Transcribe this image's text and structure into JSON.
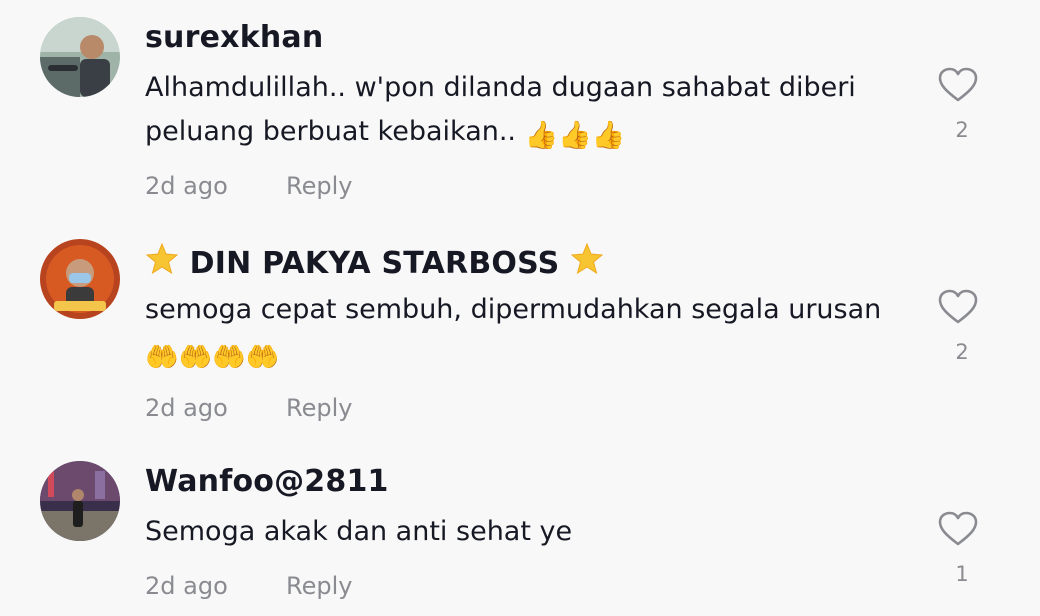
{
  "comments": [
    {
      "username": "surexkhan",
      "text": "Alhamdulillah.. w'pon dilanda dugaan sahabat diberi peluang berbuat kebaikan..",
      "emoji": "👍👍👍",
      "time": "2d ago",
      "reply_label": "Reply",
      "likes": "2",
      "avatar_icon": "user-in-car-photo"
    },
    {
      "username": "DIN PAKYA STARBOSS",
      "username_decoration": "🌟",
      "text": "semoga cepat sembuh, dipermudahkan segala urusan",
      "emoji": "🤲🤲🤲🤲",
      "time": "2d ago",
      "reply_label": "Reply",
      "likes": "2",
      "avatar_icon": "starboss-logo-photo"
    },
    {
      "username": "Wanfoo@2811",
      "text": "Semoga akak dan anti sehat ye",
      "time": "2d ago",
      "reply_label": "Reply",
      "likes": "1",
      "avatar_icon": "user-city-night-photo"
    }
  ],
  "colors": {
    "background": "#f8f8f8",
    "text_primary": "#161823",
    "text_secondary": "#8a8b91",
    "heart_outline": "#8a8b91"
  }
}
